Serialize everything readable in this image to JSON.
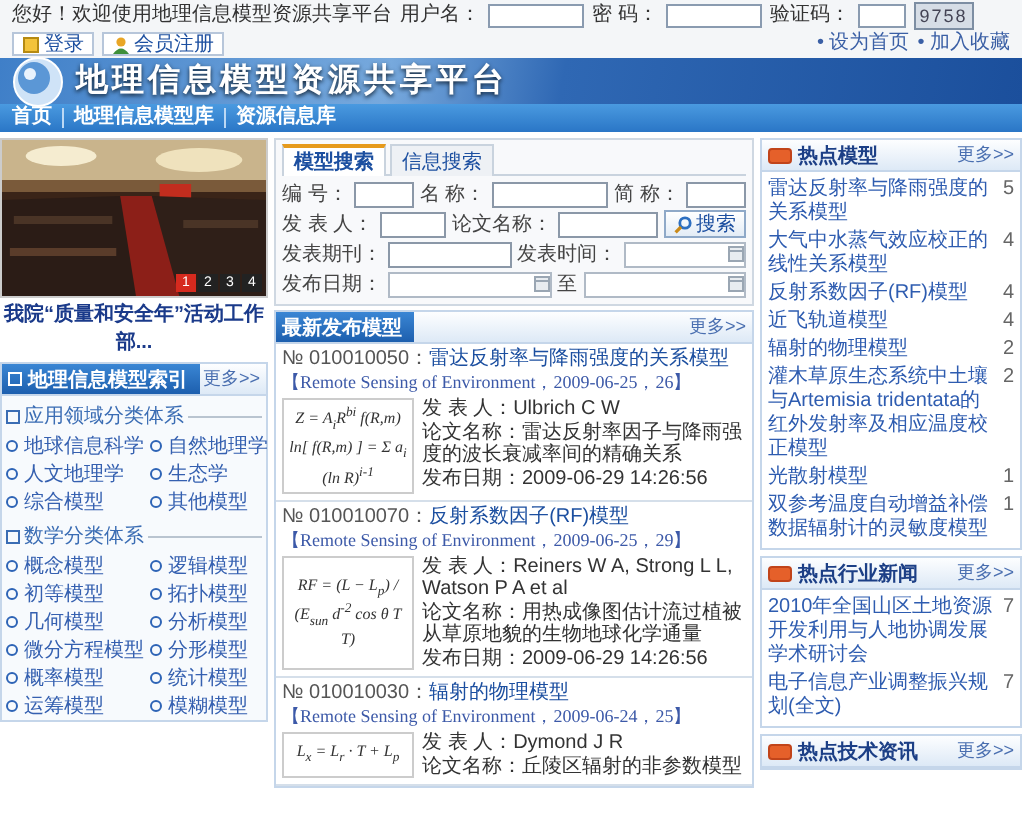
{
  "top_bar": {
    "welcome": "您好！欢迎使用地理信息模型资源共享平台",
    "username_label": "用户名：",
    "password_label": "密 码：",
    "captcha_label": "验证码：",
    "captcha": "9758",
    "login_button": "登录",
    "register_button": "会员注册",
    "links": [
      "• 设为首页",
      "• 加入收藏"
    ]
  },
  "header": {
    "title": "地理信息模型资源共享平台"
  },
  "nav": [
    "首页",
    "地理信息模型库",
    "资源信息库"
  ],
  "slideshow": {
    "caption": "我院“质量和安全年”活动工作部...",
    "pages": [
      {
        "label": "1",
        "selected": true
      },
      {
        "label": "2",
        "selected": false
      },
      {
        "label": "3",
        "selected": false
      },
      {
        "label": "4",
        "selected": false
      }
    ]
  },
  "model_index": {
    "title": "地理信息模型索引",
    "more": "更多>>",
    "groups": [
      {
        "title": "应用领域分类体系",
        "items": [
          "地球信息科学",
          "自然地理学",
          "人文地理学",
          "生态学",
          "综合模型",
          "其他模型"
        ]
      },
      {
        "title": "数学分类体系",
        "items": [
          "概念模型",
          "逻辑模型",
          "初等模型",
          "拓扑模型",
          "几何模型",
          "分析模型",
          "微分方程模型",
          "分形模型",
          "概率模型",
          "统计模型",
          "运筹模型",
          "模糊模型"
        ]
      }
    ]
  },
  "search": {
    "tabs": [
      {
        "label": "模型搜索",
        "selected": true
      },
      {
        "label": "信息搜索",
        "selected": false
      }
    ],
    "rows": [
      [
        {
          "label": "编 号：",
          "kind": "text"
        },
        {
          "label": "名 称：",
          "kind": "text"
        },
        {
          "label": "简 称：",
          "kind": "text"
        }
      ],
      [
        {
          "label": "发 表 人：",
          "kind": "text"
        },
        {
          "label": "论文名称：",
          "kind": "text"
        }
      ],
      [
        {
          "label": "发表期刊：",
          "kind": "text"
        },
        {
          "label": "发表时间：",
          "kind": "date"
        }
      ],
      [
        {
          "label": "发布日期：",
          "kind": "date"
        },
        {
          "label": "至",
          "kind": "date"
        }
      ]
    ],
    "button": "搜索"
  },
  "latest": {
    "title": "最新发布模型",
    "more": "更多>>",
    "items": [
      {
        "number": "№ 010010050：",
        "name": "雷达反射率与降雨强度的关系模型",
        "source": "【Remote Sensing of Environment，2009-06-25，26】",
        "formula": [
          "Z = A$_{i}$R$^{bi}$ f(R,m)",
          "ln[ f(R,m) ] = Σ a$_{i}$ (ln R)$^{i-1}$"
        ],
        "meta": [
          {
            "label": "发 表 人：",
            "value": "Ulbrich C W"
          },
          {
            "label": "论文名称：",
            "value": "雷达反射率因子与降雨强度的波长衰减率间的精确关系"
          },
          {
            "label": "发布日期：",
            "value": "2009-06-29 14:26:56"
          }
        ]
      },
      {
        "number": "№ 010010070：",
        "name": "反射系数因子(RF)模型",
        "source": "【Remote Sensing of Environment，2009-06-25，29】",
        "formula": [
          "RF = (L − L$_{p}$) / (E$_{sun}$ d$^{-2}$ cos θ T T)"
        ],
        "meta": [
          {
            "label": "发 表 人：",
            "value": "Reiners W A, Strong L L, Watson P A et al"
          },
          {
            "label": "论文名称：",
            "value": "用热成像图估计流过植被从草原地貌的生物地球化学通量"
          },
          {
            "label": "发布日期：",
            "value": "2009-06-29 14:26:56"
          }
        ]
      },
      {
        "number": "№ 010010030：",
        "name": "辐射的物理模型",
        "source": "【Remote Sensing of Environment，2009-06-24，25】",
        "formula": [
          "L$_{x}$ = L$_{r}$ · T + L$_{p}$"
        ],
        "meta": [
          {
            "label": "发 表 人：",
            "value": "Dymond J R"
          },
          {
            "label": "论文名称：",
            "value": "丘陵区辐射的非参数模型"
          }
        ]
      }
    ]
  },
  "hot_models": {
    "title": "热点模型",
    "more": "更多>>",
    "items": [
      {
        "name": "雷达反射率与降雨强度的关系模型",
        "count": "5"
      },
      {
        "name": "大气中水蒸气效应校正的线性关系模型",
        "count": "4"
      },
      {
        "name": "反射系数因子(RF)模型",
        "count": "4"
      },
      {
        "name": "近飞轨道模型",
        "count": "4"
      },
      {
        "name": "辐射的物理模型",
        "count": "2"
      },
      {
        "name": "灌木草原生态系统中土壤与Artemisia tridentata的红外发射率及相应温度校正模型",
        "count": "2"
      },
      {
        "name": "光散射模型",
        "count": "1"
      },
      {
        "name": "双参考温度自动增益补偿数据辐射计的灵敏度模型",
        "count": "1"
      }
    ]
  },
  "industry_news": {
    "title": "热点行业新闻",
    "more": "更多>>",
    "items": [
      {
        "name": "2010年全国山区土地资源开发利用与人地协调发展学术研讨会",
        "count": "7"
      },
      {
        "name": "电子信息产业调整振兴规划(全文)",
        "count": "7"
      }
    ]
  },
  "tech_news": {
    "title": "热点技术资讯",
    "more": "更多>>"
  }
}
